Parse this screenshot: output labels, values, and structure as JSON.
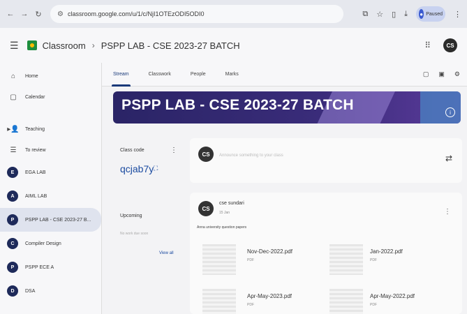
{
  "browser": {
    "url": "classroom.google.com/u/1/c/NjI1OTEzODI5ODI0",
    "profile_label": "Paused"
  },
  "header": {
    "app_name": "Classroom",
    "separator": "›",
    "class_name": "PSPP LAB - CSE 2023-27 BATCH",
    "avatar": "CS"
  },
  "sidebar": {
    "nav": [
      {
        "label": "Home"
      },
      {
        "label": "Calendar"
      },
      {
        "label": "Teaching"
      },
      {
        "label": "To review"
      }
    ],
    "classes": [
      {
        "initial": "E",
        "label": "EGA LAB"
      },
      {
        "initial": "A",
        "label": "AIML LAB"
      },
      {
        "initial": "P",
        "label": "PSPP LAB - CSE 2023-27 B..."
      },
      {
        "initial": "C",
        "label": "Compiler Design"
      },
      {
        "initial": "P",
        "label": "PSPP ECE A"
      },
      {
        "initial": "D",
        "label": "DSA"
      }
    ]
  },
  "tabs": [
    {
      "label": "Stream"
    },
    {
      "label": "Classwork"
    },
    {
      "label": "People"
    },
    {
      "label": "Marks"
    }
  ],
  "banner": {
    "title": "PSPP LAB - CSE 2023-27 BATCH"
  },
  "class_code": {
    "label": "Class code",
    "value": "qcjab7y"
  },
  "upcoming": {
    "title": "Upcoming",
    "text": "No work due soon",
    "link": "View all"
  },
  "announce": {
    "avatar": "CS",
    "placeholder": "Announce something to your class"
  },
  "post": {
    "avatar": "CS",
    "author": "cse sundari",
    "date": "15 Jan",
    "message": "Anna university question papers",
    "attachments": [
      {
        "name": "Nov-Dec-2022.pdf",
        "type": "PDF"
      },
      {
        "name": "Jan-2022.pdf",
        "type": "PDF"
      },
      {
        "name": "Apr-May-2023.pdf",
        "type": "PDF"
      },
      {
        "name": "Apr-May-2022.pdf",
        "type": "PDF"
      }
    ]
  }
}
